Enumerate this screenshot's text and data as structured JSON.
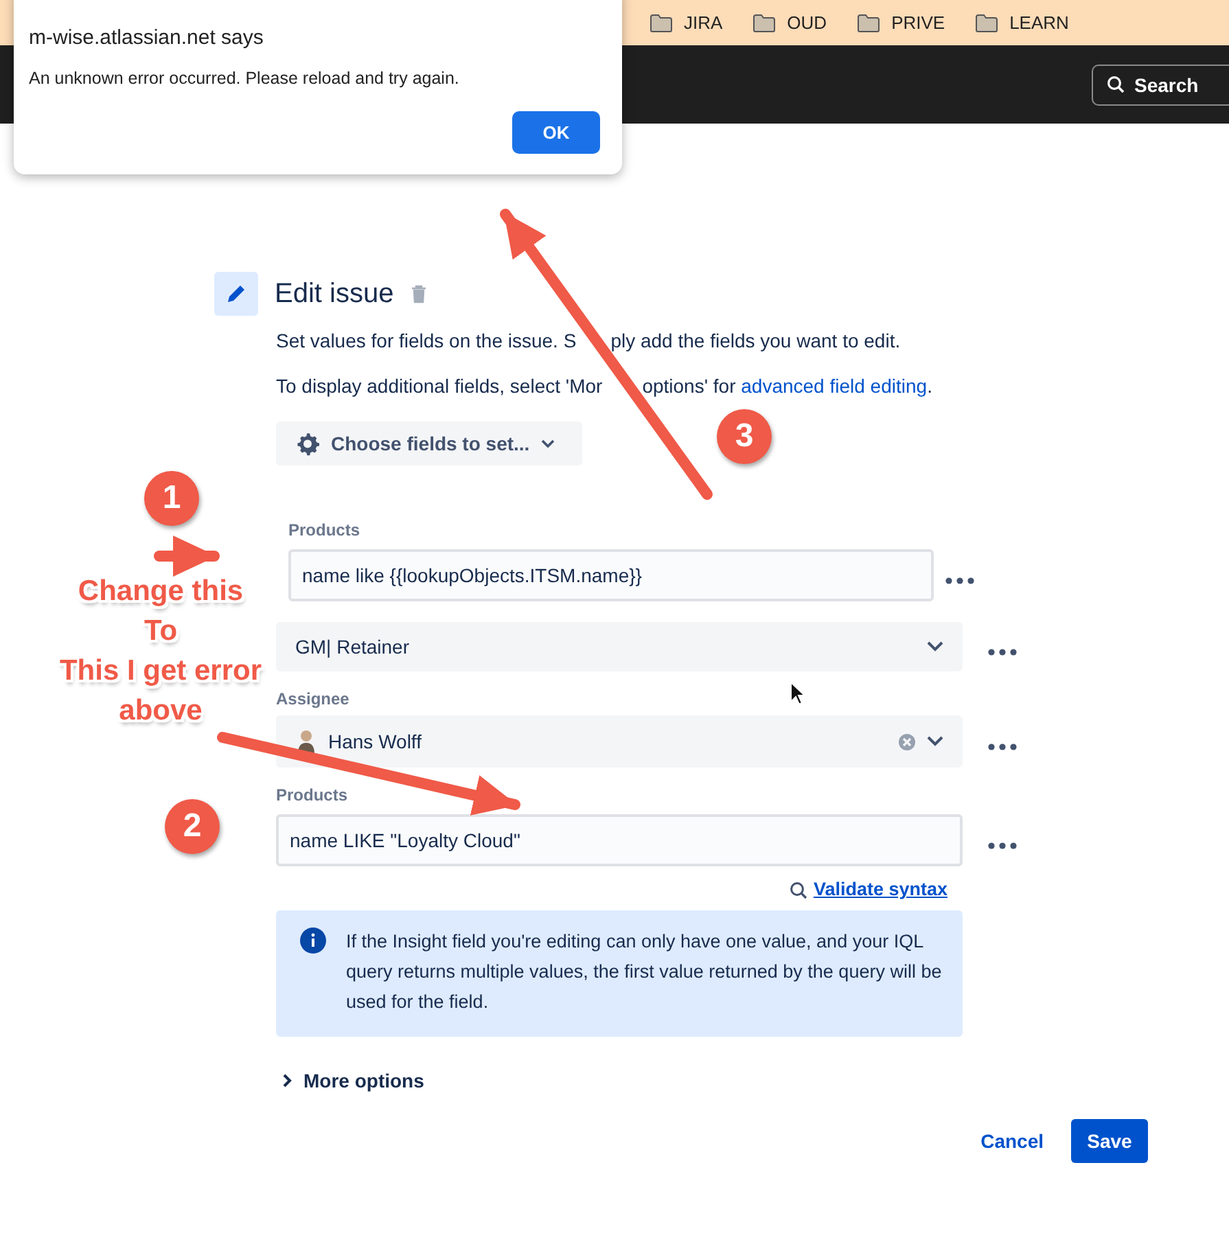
{
  "bookmarks_bar": {
    "folders": [
      {
        "label": "JIRA"
      },
      {
        "label": "OUD"
      },
      {
        "label": "PRIVE"
      },
      {
        "label": "LEARN"
      }
    ]
  },
  "header": {
    "search": {
      "placeholder": "Search"
    }
  },
  "alert_dialog": {
    "title": "m-wise.atlassian.net says",
    "message": "An unknown error occurred. Please reload and try again.",
    "button": "OK"
  },
  "edit_issue": {
    "title": "Edit issue",
    "description": [
      "Set values for fields on the issue. S",
      "ply add the fields you want to edit."
    ],
    "hint": {
      "text": [
        "To display additional fields, select 'Mor",
        "options' for "
      ],
      "link": "advanced field editing",
      "end": "."
    },
    "choose_fields_button": "Choose fields to set...",
    "fields": [
      {
        "kind": "overlay_text",
        "label": "Products",
        "value": "name like {{lookupObjects.ITSM.name}}"
      },
      {
        "kind": "select",
        "value": "GM| Retainer"
      },
      {
        "kind": "user_select",
        "label": "Assignee",
        "value": "Hans Wolff"
      },
      {
        "kind": "text",
        "label": "Products",
        "value": "name LIKE \"Loyalty Cloud\"",
        "validate_link": "Validate syntax"
      }
    ],
    "info": "If the Insight field you're editing can only have one value, and your IQL query returns multiple values, the first value returned by the query will be used for the field.",
    "more_options": {
      "label": "More options",
      "expanded": false
    },
    "actions": {
      "cancel": "Cancel",
      "save": "Save"
    }
  },
  "annotations": {
    "badges": [
      "1",
      "2",
      "3"
    ],
    "note": [
      "Change this",
      "To",
      "This I get error",
      "above"
    ]
  }
}
